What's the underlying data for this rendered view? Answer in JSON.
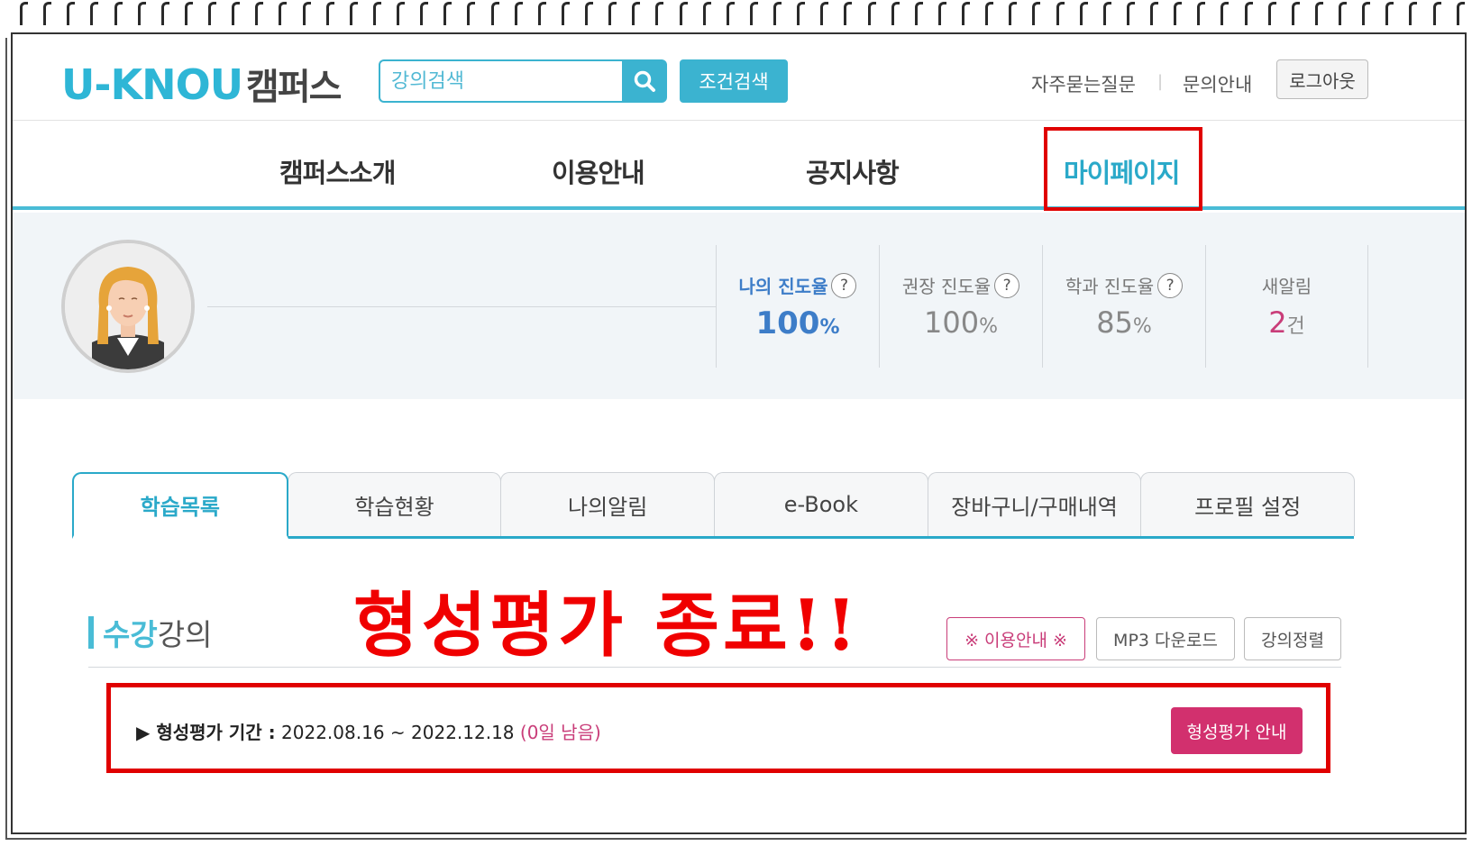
{
  "header": {
    "logo_brand": "U-KNOU",
    "logo_suffix": "캠퍼스",
    "search_placeholder": "강의검색",
    "search_icon": "search-icon",
    "condition_search_label": "조건검색",
    "faq_label": "자주묻는질문",
    "separator": "|",
    "inquiry_label": "문의안내",
    "logout_label": "로그아웃"
  },
  "nav": {
    "items": [
      {
        "label": "캠퍼스소개",
        "active": false
      },
      {
        "label": "이용안내",
        "active": false
      },
      {
        "label": "공지사항",
        "active": false
      },
      {
        "label": "마이페이지",
        "active": true
      }
    ]
  },
  "profile": {
    "avatar_icon": "user-avatar-icon",
    "stats": [
      {
        "label": "나의 진도율",
        "value": "100",
        "unit": "%",
        "help": "?"
      },
      {
        "label": "권장 진도율",
        "value": "100",
        "unit": "%",
        "help": "?"
      },
      {
        "label": "학과 진도율",
        "value": "85",
        "unit": "%",
        "help": "?"
      },
      {
        "label": "새알림",
        "value": "2",
        "unit": "건"
      }
    ]
  },
  "tabs": [
    {
      "label": "학습목록",
      "active": true
    },
    {
      "label": "학습현황",
      "active": false
    },
    {
      "label": "나의알림",
      "active": false
    },
    {
      "label": "e-Book",
      "active": false
    },
    {
      "label": "장바구니/구매내역",
      "active": false
    },
    {
      "label": "프로필 설정",
      "active": false
    }
  ],
  "section": {
    "title_highlight": "수강",
    "title_rest": "강의",
    "overlay_banner": "형성평가 종료!!",
    "usage_guide_label": "※ 이용안내 ※",
    "mp3_download_label": "MP3 다운로드",
    "sort_label": "강의정렬"
  },
  "evaluation": {
    "label": "▶ 형성평가 기간 :",
    "period": "2022.08.16 ~ 2022.12.18",
    "remaining": "(0일 남음)",
    "guide_button": "형성평가 안내"
  },
  "colors": {
    "accent": "#2aa9c9",
    "brand_blue": "#2eb6d6",
    "pink": "#c93d79",
    "highlight_red": "#e00000"
  }
}
